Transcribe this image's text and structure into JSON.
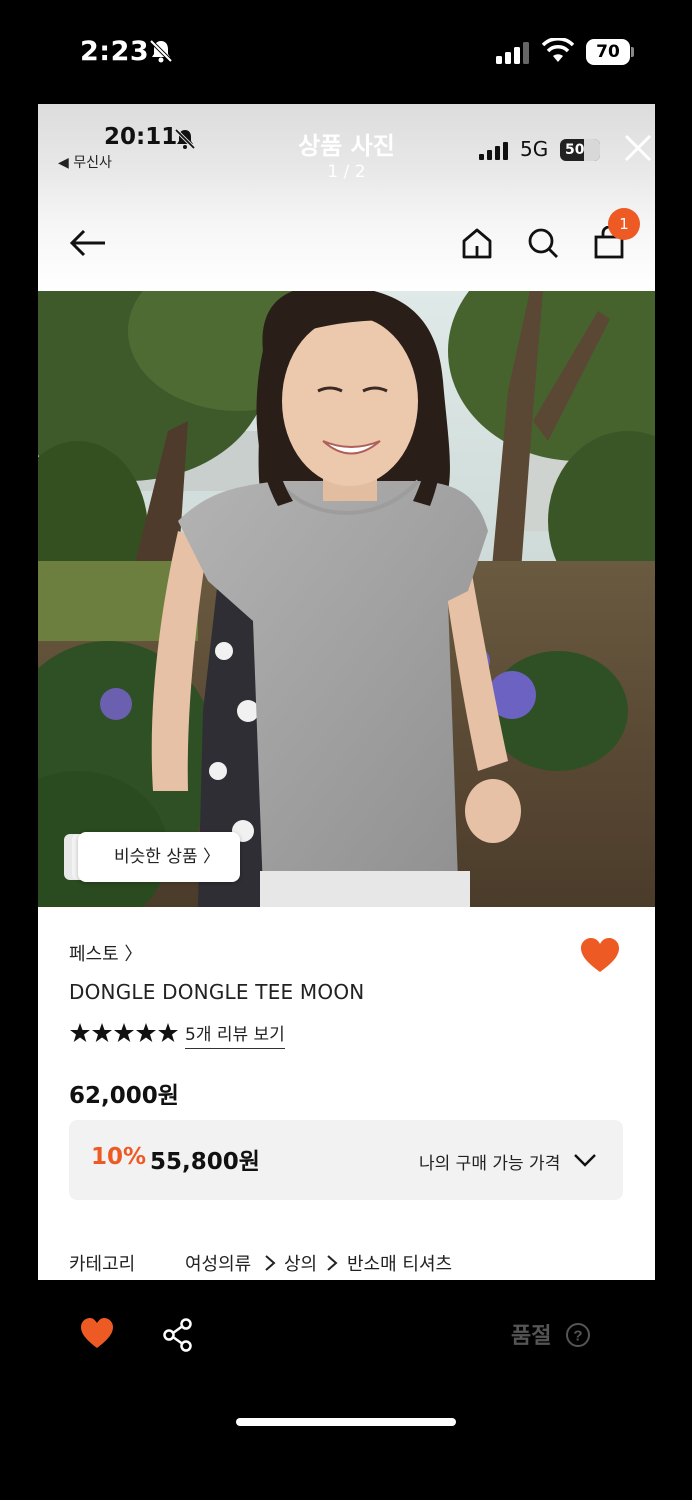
{
  "outer_status": {
    "time": "2:23",
    "battery": "70"
  },
  "inner_status": {
    "time": "20:11",
    "back_app": "◀ 무신사",
    "network": "5G",
    "battery": "50"
  },
  "viewer": {
    "title": "상품 사진",
    "counter": "1 / 2"
  },
  "header": {
    "cart_count": "1"
  },
  "photo": {
    "similar_label": "비슷한 상품 〉"
  },
  "product": {
    "brand": "페스토 〉",
    "name": "DONGLE DONGLE TEE MOON",
    "rating_stars": 5,
    "review_link": "5개 리뷰 보기",
    "price": "62,000원",
    "discount": "10%",
    "sale_price": "55,800원",
    "my_price_label": "나의 구매 가능 가격"
  },
  "category": {
    "label": "카테고리",
    "path": [
      "여성의류",
      "상의",
      "반소매 티셔츠"
    ]
  },
  "bottom_bar": {
    "status": "품절"
  },
  "colors": {
    "accent": "#ee5a24",
    "price_box": "#f2f2f2"
  },
  "icons": [
    "bell-slash-icon",
    "signal-icon",
    "wifi-icon",
    "battery-icon",
    "close-icon",
    "back-arrow-icon",
    "home-icon",
    "search-icon",
    "cart-icon",
    "heart-icon",
    "star-icon",
    "chevron-down-icon",
    "share-icon",
    "help-icon"
  ]
}
